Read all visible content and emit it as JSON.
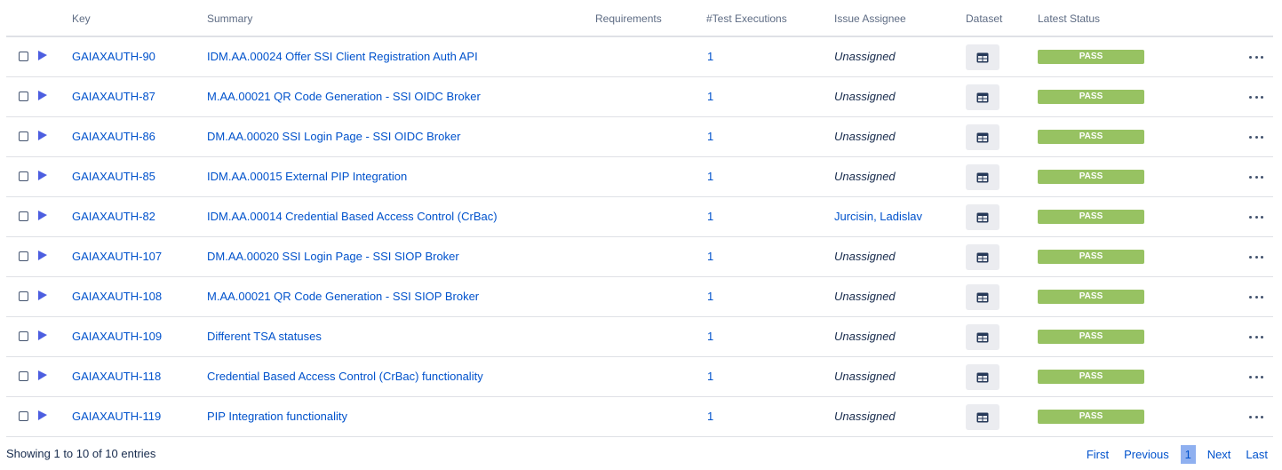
{
  "columns": {
    "key": "Key",
    "summary": "Summary",
    "requirements": "Requirements",
    "test_executions": "#Test Executions",
    "issue_assignee": "Issue Assignee",
    "dataset": "Dataset",
    "latest_status": "Latest Status"
  },
  "rows": [
    {
      "key": "GAIAXAUTH-90",
      "summary": "IDM.AA.00024 Offer SSI Client Registration Auth API",
      "executions": "1",
      "assignee": "Unassigned",
      "assigned": false,
      "status": "PASS"
    },
    {
      "key": "GAIAXAUTH-87",
      "summary": "M.AA.00021 QR Code Generation - SSI OIDC Broker",
      "executions": "1",
      "assignee": "Unassigned",
      "assigned": false,
      "status": "PASS"
    },
    {
      "key": "GAIAXAUTH-86",
      "summary": "DM.AA.00020 SSI Login Page - SSI OIDC Broker",
      "executions": "1",
      "assignee": "Unassigned",
      "assigned": false,
      "status": "PASS"
    },
    {
      "key": "GAIAXAUTH-85",
      "summary": "IDM.AA.00015 External PIP Integration",
      "executions": "1",
      "assignee": "Unassigned",
      "assigned": false,
      "status": "PASS"
    },
    {
      "key": "GAIAXAUTH-82",
      "summary": "IDM.AA.00014 Credential Based Access Control (CrBac)",
      "executions": "1",
      "assignee": "Jurcisin, Ladislav",
      "assigned": true,
      "status": "PASS"
    },
    {
      "key": "GAIAXAUTH-107",
      "summary": "DM.AA.00020 SSI Login Page - SSI SIOP Broker",
      "executions": "1",
      "assignee": "Unassigned",
      "assigned": false,
      "status": "PASS"
    },
    {
      "key": "GAIAXAUTH-108",
      "summary": "M.AA.00021 QR Code Generation - SSI SIOP Broker",
      "executions": "1",
      "assignee": "Unassigned",
      "assigned": false,
      "status": "PASS"
    },
    {
      "key": "GAIAXAUTH-109",
      "summary": "Different TSA statuses",
      "executions": "1",
      "assignee": "Unassigned",
      "assigned": false,
      "status": "PASS"
    },
    {
      "key": "GAIAXAUTH-118",
      "summary": "Credential Based Access Control (CrBac) functionality",
      "executions": "1",
      "assignee": "Unassigned",
      "assigned": false,
      "status": "PASS"
    },
    {
      "key": "GAIAXAUTH-119",
      "summary": "PIP Integration functionality",
      "executions": "1",
      "assignee": "Unassigned",
      "assigned": false,
      "status": "PASS"
    }
  ],
  "row_icons": {
    "play": "play-icon",
    "dataset": "dataset-table-icon",
    "more": "more-actions-icon"
  },
  "colors": {
    "link": "#0052cc",
    "pass": "#97c262",
    "play": "#4c5ee0",
    "current_page": "#8fb0f0"
  },
  "footer": {
    "info": "Showing 1 to 10 of 10 entries",
    "first": "First",
    "previous": "Previous",
    "current_page": "1",
    "next": "Next",
    "last": "Last"
  }
}
